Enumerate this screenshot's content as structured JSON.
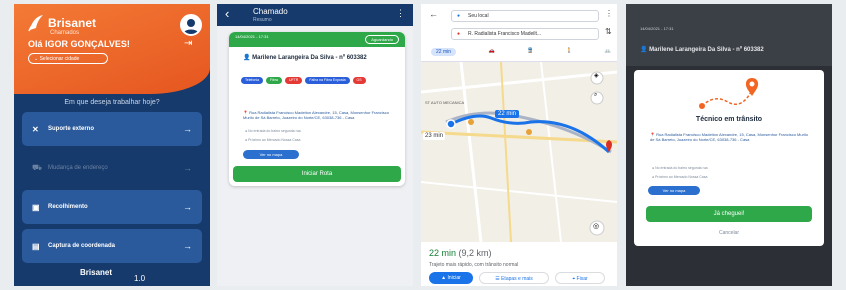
{
  "screen1": {
    "brand": "Brisanet",
    "brand_sub": "Chamados",
    "greeting": "Olá IGOR GONÇALVES!",
    "city_select": "Selecionar cidade",
    "question": "Em que deseja trabalhar hoje?",
    "menu": [
      {
        "label": "Suporte externo",
        "icon": "wrench-icon",
        "enabled": true
      },
      {
        "label": "Mudança de endereço",
        "icon": "truck-icon",
        "enabled": false
      },
      {
        "label": "Recolhimento",
        "icon": "box-icon",
        "enabled": true
      },
      {
        "label": "Captura de coordenada",
        "icon": "map-pin-icon",
        "enabled": true
      }
    ],
    "footer_brand": "Brisanet",
    "version": "1.0"
  },
  "screen2": {
    "title": "Chamado",
    "subtitle": "Resumo",
    "card_header": "14/04/2021 - 17:31",
    "card_badge": "Aguardando",
    "client_name": "Marilene Larangeira Da Silva - nº 603382",
    "tags": [
      {
        "label": "Telefonia",
        "color": "#2b5fd9"
      },
      {
        "label": "Fibra",
        "color": "#2fa84a"
      },
      {
        "label": "UFTR",
        "color": "#e53935"
      },
      {
        "label": "Falha na Fibra Exposta",
        "color": "#2b5fd9"
      },
      {
        "label": "OS",
        "color": "#e53935"
      }
    ],
    "address": "Rua Radialista Francisco Madeiton Alexandre, 15, Casa, Monsenhor Francisco Murilo de Sá Barreto, Juazeiro do Norte/CE, 63038-736 - Casa",
    "info1": "No entrada do bairro segunda rua",
    "info2": "Próximo ao Mercado Nossa Casa",
    "maps_button": "Ver no mapa",
    "start_button": "Iniciar Rota"
  },
  "screen3": {
    "origin": "Seu local",
    "destination": "R. Radialista Francisco Madeilt...",
    "modes": [
      "22 min",
      "🚗",
      "🚆",
      "🚶",
      "🚲"
    ],
    "eta_time": "22 min",
    "eta_distance": "(9,2 km)",
    "note": "Trajeto mais rápido, com trânsito normal",
    "start": "Iniciar",
    "steps": "Etapas e mais",
    "pin": "Fixar",
    "map_label_route": "22 min",
    "map_label_alt": "23 min",
    "map_place": "ST AUTO MECANICA"
  },
  "screen4": {
    "bg_header": "14/04/2021 - 17:31",
    "bg_name": "Marilene Larangeira Da Silva - nº 603382",
    "modal_title": "Técnico em trânsito",
    "address": "Rua Radialista Francisco Madeiton Alexandre, 15, Casa, Monsenhor Francisco Murilo de Sá Barreto, Juazeiro do Norte/CE, 63038-736 - Casa",
    "info1": "No entrada do bairro segunda rua",
    "info2": "Próximo ao Mercado Nossa Casa",
    "maps_button": "Ver no mapa",
    "arrived_button": "Já cheguei!",
    "cancel": "Cancelar"
  }
}
